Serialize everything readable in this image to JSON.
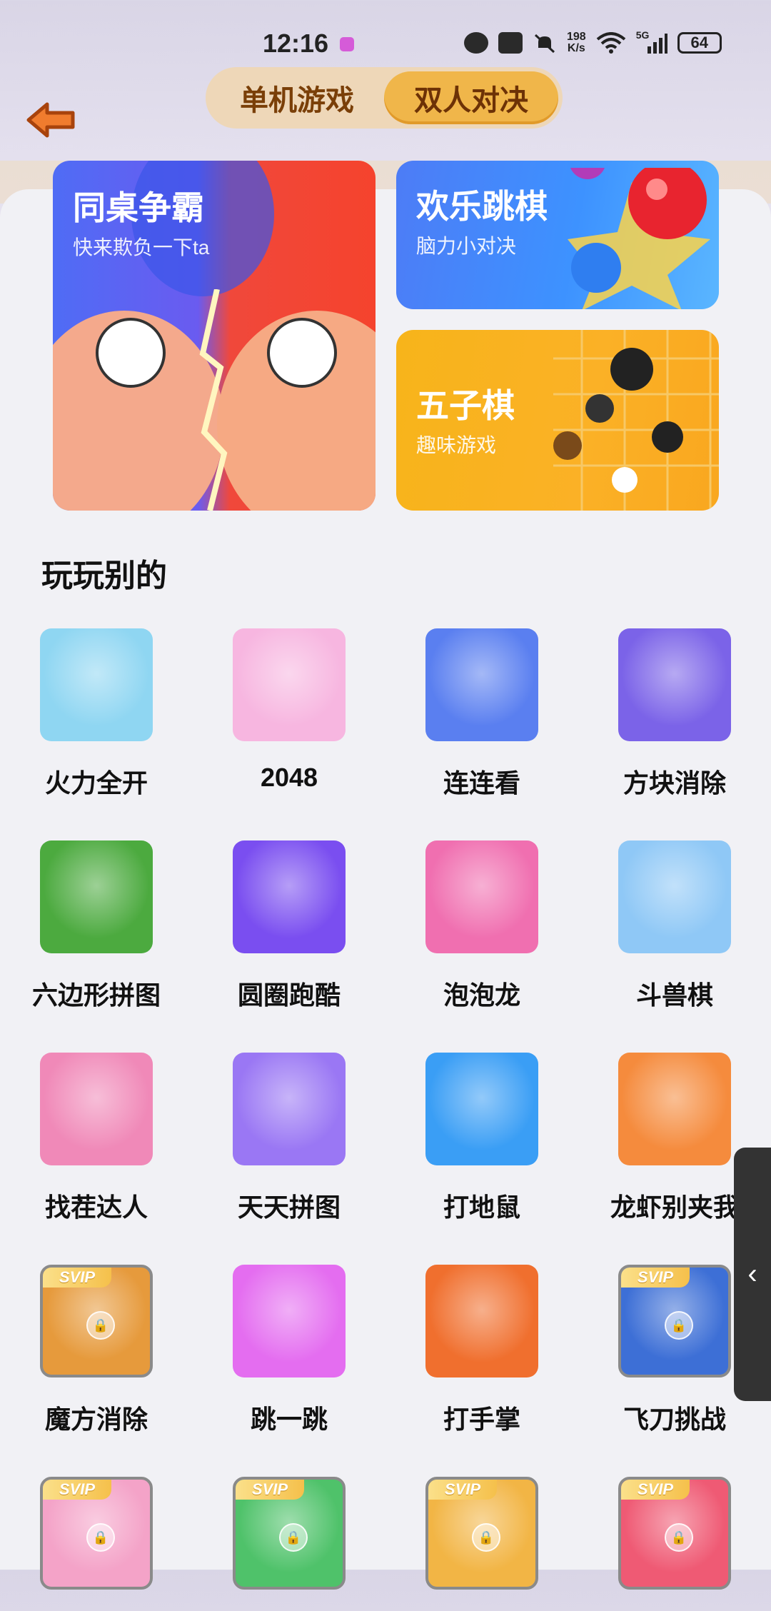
{
  "status_bar": {
    "time": "12:16",
    "speed_value": "198",
    "speed_unit": "K/s",
    "network": "5G",
    "battery": "64"
  },
  "header": {
    "tabs": [
      {
        "label": "单机游戏",
        "active": false
      },
      {
        "label": "双人对决",
        "active": true
      }
    ]
  },
  "featured": [
    {
      "title": "同桌争霸",
      "subtitle": "快来欺负一下ta"
    },
    {
      "title": "欢乐跳棋",
      "subtitle": "脑力小对决"
    },
    {
      "title": "五子棋",
      "subtitle": "趣味游戏"
    }
  ],
  "section_title": "玩玩别的",
  "svip_label": "SVIP",
  "games": [
    {
      "name": "火力全开",
      "bg": "#8fd6f2",
      "svip": false
    },
    {
      "name": "2048",
      "bg": "#f7b6e0",
      "svip": false
    },
    {
      "name": "连连看",
      "bg": "#5a7ff0",
      "svip": false
    },
    {
      "name": "方块消除",
      "bg": "#7b63e8",
      "svip": false
    },
    {
      "name": "六边形拼图",
      "bg": "#4caa3f",
      "svip": false
    },
    {
      "name": "圆圈跑酷",
      "bg": "#7a4ef0",
      "svip": false
    },
    {
      "name": "泡泡龙",
      "bg": "#f06fb0",
      "svip": false
    },
    {
      "name": "斗兽棋",
      "bg": "#8fc8f6",
      "svip": false
    },
    {
      "name": "找茬达人",
      "bg": "#f089b8",
      "svip": false
    },
    {
      "name": "天天拼图",
      "bg": "#9a77f4",
      "svip": false
    },
    {
      "name": "打地鼠",
      "bg": "#3a9ef5",
      "svip": false
    },
    {
      "name": "龙虾别夹我",
      "bg": "#f58b3d",
      "svip": false
    },
    {
      "name": "魔方消除",
      "bg": "#e69a3c",
      "svip": true
    },
    {
      "name": "跳一跳",
      "bg": "#e46df0",
      "svip": false
    },
    {
      "name": "打手掌",
      "bg": "#f06f2e",
      "svip": false
    },
    {
      "name": "飞刀挑战",
      "bg": "#3d6fd6",
      "svip": true
    },
    {
      "name": "",
      "bg": "#f4a3c8",
      "svip": true
    },
    {
      "name": "",
      "bg": "#4fc26a",
      "svip": true
    },
    {
      "name": "",
      "bg": "#f2b545",
      "svip": true
    },
    {
      "name": "",
      "bg": "#ef5a74",
      "svip": true
    }
  ]
}
